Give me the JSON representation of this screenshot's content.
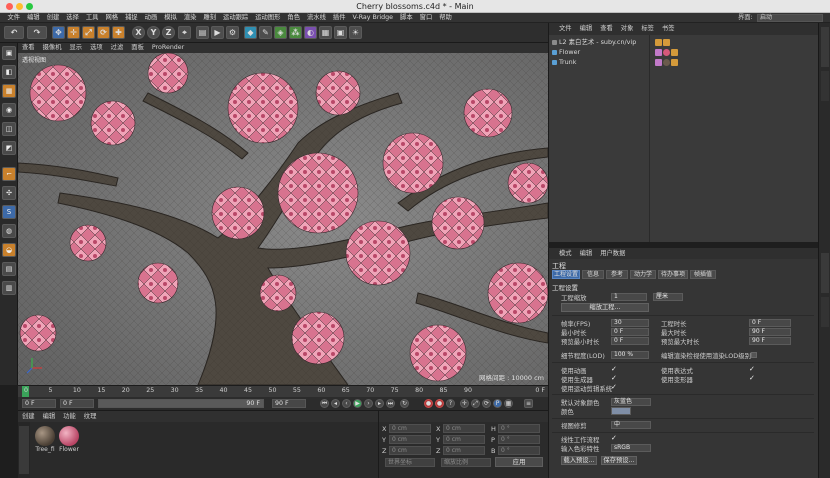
{
  "window": {
    "title": "Cherry blossoms.c4d * - Main"
  },
  "menubar": {
    "items": [
      "文件",
      "编辑",
      "创建",
      "选择",
      "工具",
      "网格",
      "捕捉",
      "动画",
      "模拟",
      "渲染",
      "雕刻",
      "运动跟踪",
      "运动图形",
      "角色",
      "流水线",
      "插件",
      "V-Ray Bridge",
      "脚本",
      "窗口",
      "帮助"
    ],
    "layout_label": "界面:",
    "layout_value": "启动"
  },
  "toolbar": {
    "icons": [
      "undo-icon",
      "redo-icon",
      "move-icon",
      "scale-icon",
      "rotate-icon",
      "select-x-icon",
      "select-y-icon",
      "select-z-icon",
      "coord-system-icon",
      "render-region-icon",
      "render-view-icon",
      "render-settings-icon",
      "cube-icon",
      "pen-icon",
      "subdivision-icon",
      "array-icon",
      "deformer-icon",
      "environment-icon",
      "camera-icon",
      "light-icon"
    ],
    "axis_x": "X",
    "axis_y": "Y",
    "axis_z": "Z"
  },
  "viewport": {
    "menu": [
      "查看",
      "摄像机",
      "显示",
      "选项",
      "过滤",
      "面板",
      "ProRender"
    ],
    "label": "透视视图",
    "grid_info": "网格间距 : 10000 cm"
  },
  "timeline": {
    "ticks": [
      "0",
      "5",
      "10",
      "15",
      "20",
      "25",
      "30",
      "35",
      "40",
      "45",
      "50",
      "55",
      "60",
      "65",
      "70",
      "75",
      "80",
      "85",
      "90"
    ],
    "current_frame": "0 F"
  },
  "transport": {
    "start": "0 F",
    "current": "0 F",
    "preview_end": "90 F",
    "end": "90 F"
  },
  "material_manager": {
    "menu": [
      "创建",
      "编辑",
      "功能",
      "纹理"
    ],
    "materials": [
      {
        "name": "Tree_fi",
        "color": "#6a5a4c"
      },
      {
        "name": "Flower",
        "color": "#d4587a"
      }
    ]
  },
  "coordinates": {
    "rows": [
      {
        "axis": "X",
        "pos": "0 cm",
        "axis2": "X",
        "size": "0 cm",
        "rot_label": "H",
        "rot": "0 °"
      },
      {
        "axis": "Y",
        "pos": "0 cm",
        "axis2": "Y",
        "size": "0 cm",
        "rot_label": "P",
        "rot": "0 °"
      },
      {
        "axis": "Z",
        "pos": "0 cm",
        "axis2": "Z",
        "size": "0 cm",
        "rot_label": "B",
        "rot": "0 °"
      }
    ],
    "mode1": "世界坐标",
    "mode2": "缩放比例",
    "apply": "应用"
  },
  "object_manager": {
    "menu": [
      "文件",
      "编辑",
      "查看",
      "对象",
      "标签",
      "书签"
    ],
    "objects": [
      {
        "name": "L2 素白艺术 - suby.cn/vip",
        "color": "#8a8a8a"
      },
      {
        "name": "Flower",
        "color": "#5a9fd4"
      },
      {
        "name": "Trunk",
        "color": "#5a9fd4"
      }
    ]
  },
  "attribute_manager": {
    "menu": [
      "模式",
      "编辑",
      "用户数据"
    ],
    "title": "工程",
    "tabs": [
      "工程设置",
      "信息",
      "参考",
      "动力学",
      "待办事项",
      "帧插值"
    ],
    "section": "工程设置",
    "project_scale_label": "工程缩放",
    "project_scale_value": "1",
    "project_scale_unit": "厘米",
    "scale_project_btn": "缩放工程...",
    "fps_label": "帧率(FPS)",
    "fps_value": "30",
    "project_time_label": "工程时长",
    "project_time_value": "0 F",
    "min_time_label": "最小时长",
    "min_time_value": "0 F",
    "max_time_label": "最大时长",
    "max_time_value": "90 F",
    "preview_min_label": "预览最小时长",
    "preview_min_value": "0 F",
    "preview_max_label": "预览最大时长",
    "preview_max_value": "90 F",
    "lod_label": "细节程度(LOD)",
    "lod_value": "100 %",
    "lod_render_label": "编辑渲染检视使用渲染LOD级别",
    "use_anim_label": "使用动画",
    "use_expr_label": "使用表达式",
    "use_gen_label": "使用生成器",
    "use_deform_label": "使用变形器",
    "use_motion_label": "使用运动剪辑系统",
    "default_color_label": "默认对象颜色",
    "default_color_value": "灰蓝色",
    "color_label": "颜色",
    "view_clip_label": "视图修剪",
    "view_clip_value": "中",
    "linear_workflow_label": "线性工作流程",
    "input_color_label": "输入色彩特性",
    "input_color_value": "sRGB",
    "load_preset": "载入预设...",
    "save_preset": "保存预设..."
  },
  "colors": {
    "accent": "#3d6aa8",
    "viewport_bg": "#6c6c6c",
    "blossom": "#e2809c"
  }
}
